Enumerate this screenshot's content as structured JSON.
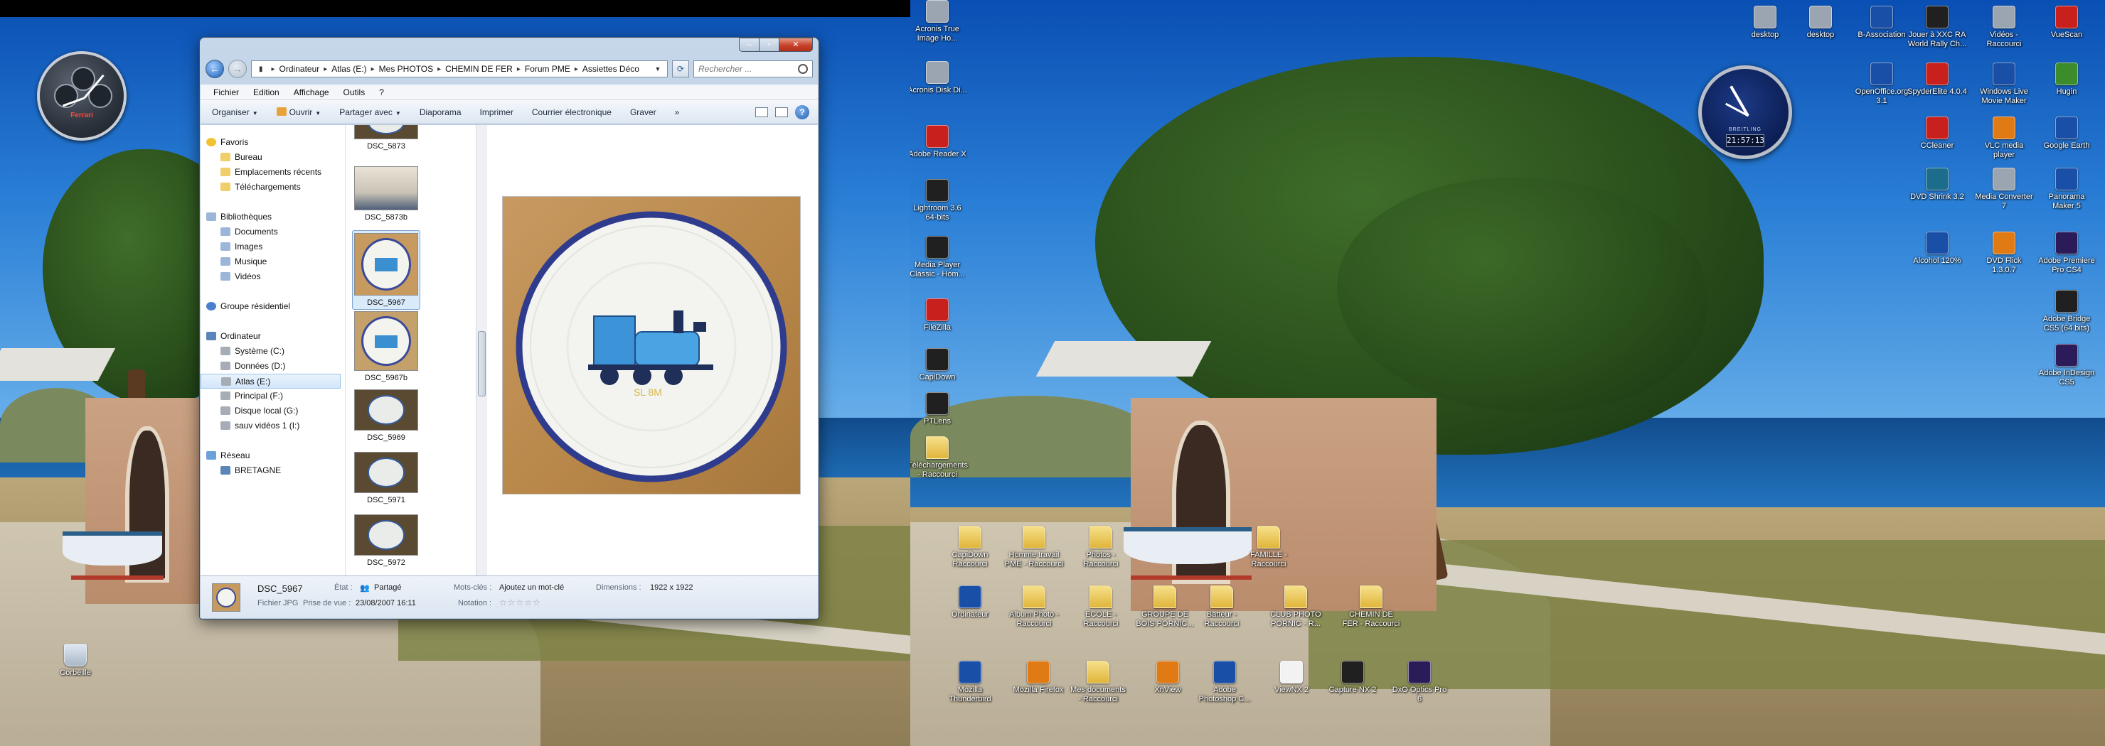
{
  "window": {
    "address": [
      "Ordinateur",
      "Atlas (E:)",
      "Mes PHOTOS",
      "CHEMIN DE FER",
      "Forum PME",
      "Assiettes Déco"
    ],
    "search_placeholder": "Rechercher ...",
    "menu": [
      "Fichier",
      "Edition",
      "Affichage",
      "Outils",
      "?"
    ],
    "commands": {
      "organize": "Organiser",
      "open": "Ouvrir",
      "share": "Partager avec",
      "slideshow": "Diaporama",
      "print": "Imprimer",
      "email": "Courrier électronique",
      "burn": "Graver",
      "more": "»"
    },
    "nav": {
      "favorites": "Favoris",
      "fav_items": [
        "Bureau",
        "Emplacements récents",
        "Téléchargements"
      ],
      "libraries": "Bibliothèques",
      "lib_items": [
        "Documents",
        "Images",
        "Musique",
        "Vidéos"
      ],
      "homegroup": "Groupe résidentiel",
      "computer": "Ordinateur",
      "drives": [
        "Système (C:)",
        "Données (D:)",
        "Atlas (E:)",
        "Principal (F:)",
        "Disque local (G:)",
        "sauv vidéos 1 (I:)"
      ],
      "network": "Réseau",
      "net_items": [
        "BRETAGNE"
      ]
    },
    "thumbnails": [
      "DSC_5873",
      "DSC_5873b",
      "DSC_5967",
      "DSC_5967b",
      "DSC_5969",
      "DSC_5971",
      "DSC_5972"
    ],
    "details": {
      "name": "DSC_5967",
      "type": "Fichier JPG",
      "state_label": "État :",
      "state_value": "Partagé",
      "date_label": "Prise de vue :",
      "date_value": "23/08/2007 16:11",
      "keywords_label": "Mots-clés :",
      "keywords_value": "Ajoutez un mot-clé",
      "rating_label": "Notation :",
      "rating_value": "☆☆☆☆☆",
      "dim_label": "Dimensions :",
      "dim_value": "1922 x 1922"
    }
  },
  "gadgets": {
    "left_clock_brand": "Ferrari",
    "right_clock_brand": "BREITLING",
    "right_clock_time": "21:57:13"
  },
  "desktop_left": [
    {
      "label": "Corbeille",
      "icon": "trash"
    }
  ],
  "desktop_right": [
    {
      "label": "Acronis True Image Ho...",
      "icon": "app-grey"
    },
    {
      "label": "Acronis Disk Di...",
      "icon": "app-grey"
    },
    {
      "label": "Adobe Reader X",
      "icon": "app-red"
    },
    {
      "label": "Lightroom 3.6 64-bits",
      "icon": "app-dark"
    },
    {
      "label": "Media Player Classic - Hom...",
      "icon": "app-dark"
    },
    {
      "label": "FileZilla",
      "icon": "app-red"
    },
    {
      "label": "CapiDown",
      "icon": "app-dark"
    },
    {
      "label": "PTLens",
      "icon": "app-dark"
    },
    {
      "label": "Téléchargements - Raccourci",
      "icon": "folder"
    },
    {
      "label": "CapiDown Raccourci",
      "icon": "folder"
    },
    {
      "label": "Homme travail PME - Raccourci",
      "icon": "folder"
    },
    {
      "label": "Photos - Raccourci",
      "icon": "folder"
    },
    {
      "label": "FAMILLE - Raccourci",
      "icon": "folder"
    },
    {
      "label": "Ordinateur",
      "icon": "app-blue"
    },
    {
      "label": "Album Photo - Raccourci",
      "icon": "folder"
    },
    {
      "label": "ECOLE - Raccourci",
      "icon": "folder"
    },
    {
      "label": "GROUPE DE BOIS PORNIC...",
      "icon": "folder"
    },
    {
      "label": "Batteur - Raccourci",
      "icon": "folder"
    },
    {
      "label": "CLUB PHOTO PORNIC - R...",
      "icon": "folder"
    },
    {
      "label": "CHEMIN DE FER - Raccourci",
      "icon": "folder"
    },
    {
      "label": "Mozilla Thunderbird",
      "icon": "app-blue"
    },
    {
      "label": "Mozilla Firefox",
      "icon": "app-orange"
    },
    {
      "label": "Mes documents - Raccourci",
      "icon": "folder"
    },
    {
      "label": "XnView",
      "icon": "app-orange"
    },
    {
      "label": "Adobe Photoshop C...",
      "icon": "app-blue"
    },
    {
      "label": "ViewNX 2",
      "icon": "app-white"
    },
    {
      "label": "Capture NX 2",
      "icon": "app-dark"
    },
    {
      "label": "DxO Optics Pro 6",
      "icon": "app-purple"
    },
    {
      "label": "desktop",
      "icon": "app-grey"
    },
    {
      "label": "desktop",
      "icon": "app-grey"
    },
    {
      "label": "B-Association",
      "icon": "app-blue"
    },
    {
      "label": "Jouer à XXC RA World Rally Ch...",
      "icon": "app-dark"
    },
    {
      "label": "Vidéos - Raccourci",
      "icon": "app-grey"
    },
    {
      "label": "VueScan",
      "icon": "app-red"
    },
    {
      "label": "OpenOffice.org 3.1",
      "icon": "app-blue"
    },
    {
      "label": "SpyderElite 4.0.4",
      "icon": "app-red"
    },
    {
      "label": "Windows Live Movie Maker",
      "icon": "app-blue"
    },
    {
      "label": "Hugin",
      "icon": "app-green"
    },
    {
      "label": "CCleaner",
      "icon": "app-red"
    },
    {
      "label": "VLC media player",
      "icon": "app-orange"
    },
    {
      "label": "Google Earth",
      "icon": "app-blue"
    },
    {
      "label": "DVD Shrink 3.2",
      "icon": "app-teal"
    },
    {
      "label": "Media Converter 7",
      "icon": "app-grey"
    },
    {
      "label": "Panorama Maker 5",
      "icon": "app-blue"
    },
    {
      "label": "Alcohol 120%",
      "icon": "app-blue"
    },
    {
      "label": "DVD Flick 1.3.0.7",
      "icon": "app-orange"
    },
    {
      "label": "Adobe Premiere Pro CS4",
      "icon": "app-purple"
    },
    {
      "label": "Adobe Bridge CS5 (64 bits)",
      "icon": "app-dark"
    },
    {
      "label": "Adobe InDesign CS5",
      "icon": "app-purple"
    }
  ]
}
